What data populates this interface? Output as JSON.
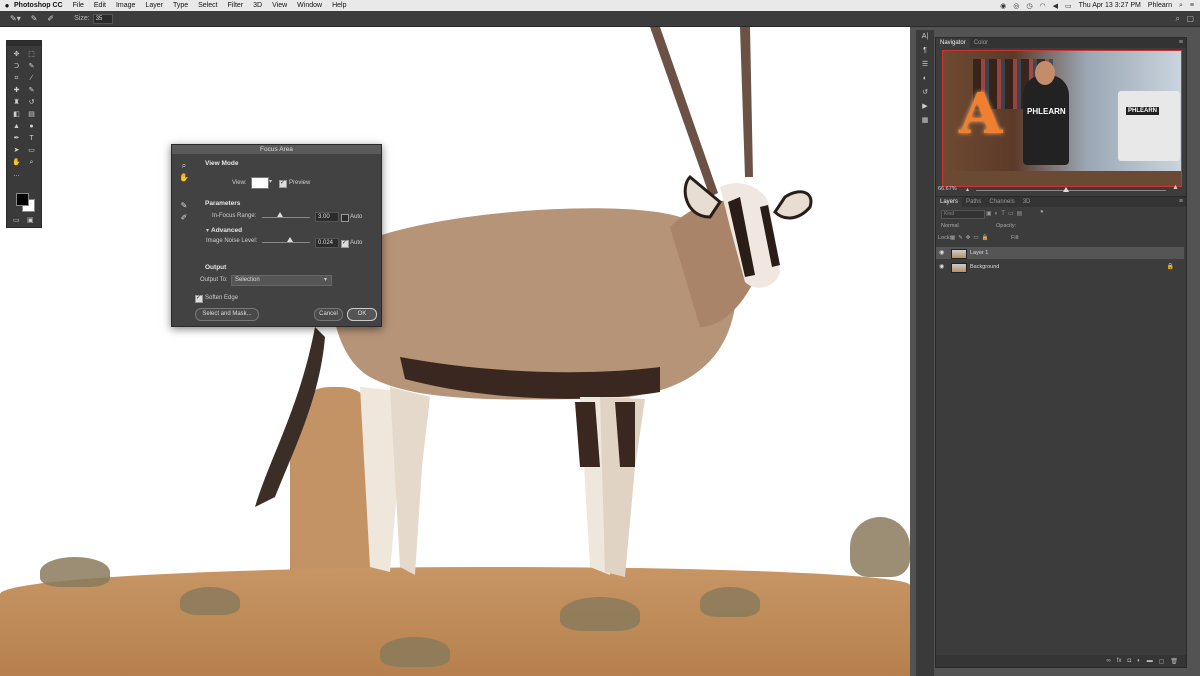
{
  "menubar": {
    "apple": "",
    "app_name": "Photoshop CC",
    "items": [
      "File",
      "Edit",
      "Image",
      "Layer",
      "Type",
      "Select",
      "Filter",
      "3D",
      "View",
      "Window",
      "Help"
    ],
    "datetime": "Thu Apr 13  3:27 PM",
    "user": "Phlearn"
  },
  "options_bar": {
    "size_label": "Size:",
    "size_value": "35"
  },
  "dialog": {
    "title": "Focus Area",
    "view_mode_title": "View Mode",
    "view_label": "View:",
    "preview_label": "Preview",
    "parameters_title": "Parameters",
    "in_focus_label": "In-Focus Range:",
    "in_focus_value": "3.00",
    "auto_label_1": "Auto",
    "advanced_title": "Advanced",
    "noise_label": "Image Noise Level:",
    "noise_value": "0.024",
    "auto_label_2": "Auto",
    "output_title": "Output",
    "output_to_label": "Output To:",
    "output_to_value": "Selection",
    "soften_edge_label": "Soften Edge",
    "select_mask_label": "Select and Mask...",
    "cancel_label": "Cancel",
    "ok_label": "OK",
    "preview_checked": true,
    "auto1_checked": false,
    "auto2_checked": true,
    "soften_checked": true
  },
  "navigator": {
    "tabs": [
      "Navigator",
      "Color"
    ],
    "zoom": "66.67%",
    "shirt_text": "PHLEARN",
    "monitor_text": "PHLEARN",
    "letter": "A"
  },
  "layers": {
    "tabs": [
      "Layers",
      "Paths",
      "Channels",
      "3D"
    ],
    "kind_label": "Kind",
    "blend_mode": "Normal",
    "opacity_label": "Opacity:",
    "lock_label": "Lock:",
    "fill_label": "Fill:",
    "items": [
      {
        "name": "Layer 1",
        "selected": true
      },
      {
        "name": "Background",
        "selected": false
      }
    ]
  }
}
